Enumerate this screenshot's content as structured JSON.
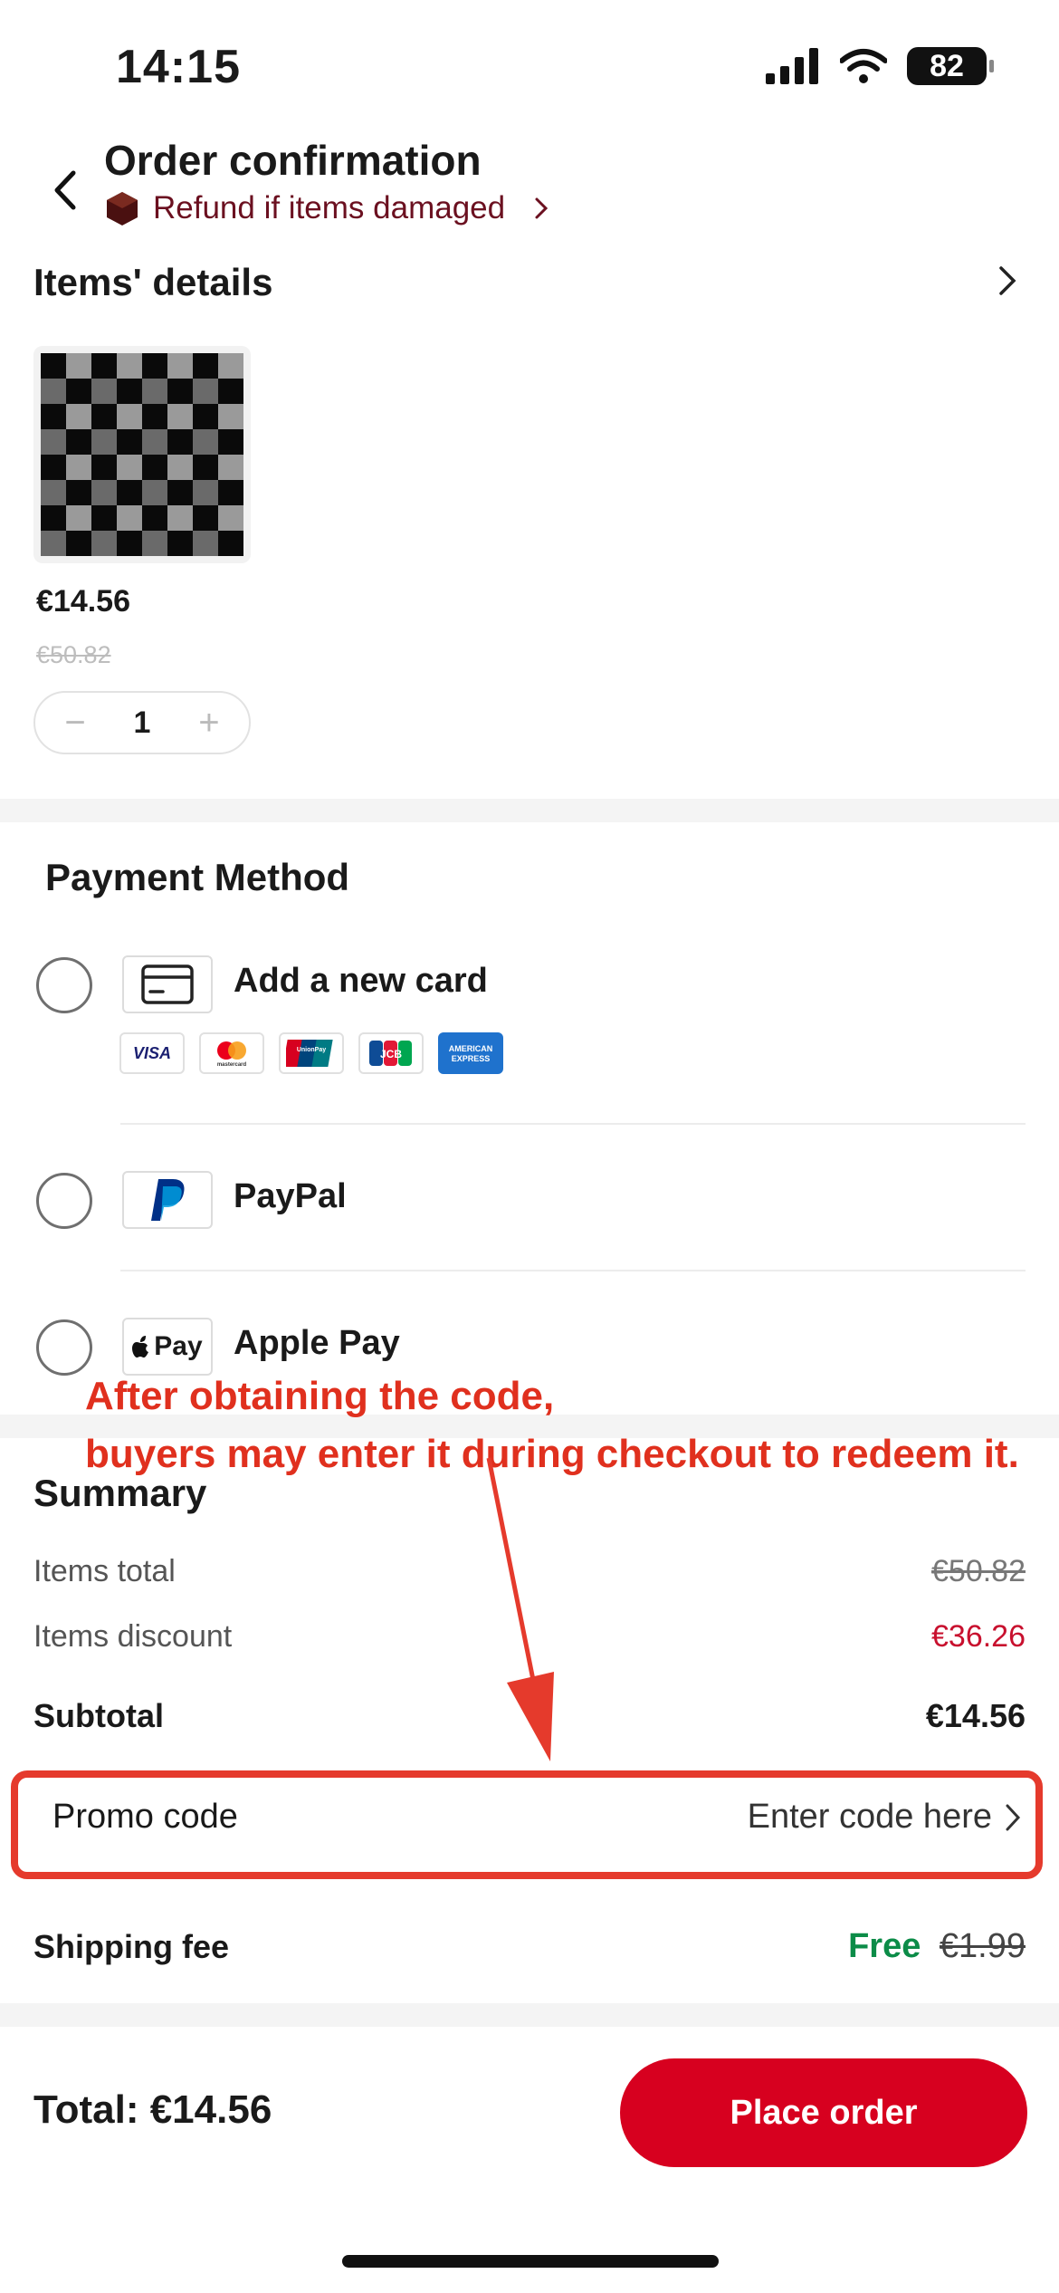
{
  "status": {
    "time": "14:15",
    "battery": "82"
  },
  "header": {
    "title": "Order confirmation",
    "refund_text": "Refund if items damaged"
  },
  "items": {
    "title": "Items' details",
    "price": "€14.56",
    "original_price": "€50.82",
    "quantity": "1",
    "minus": "−",
    "plus": "+"
  },
  "payment": {
    "title": "Payment Method",
    "options": [
      {
        "label": "Add a new card",
        "icon": "credit-card-icon"
      },
      {
        "label": "PayPal",
        "icon": "paypal-icon"
      },
      {
        "label": "Apple Pay",
        "icon": "apple-pay-icon",
        "badge": "Pay"
      }
    ],
    "card_logos": [
      "VISA",
      "mastercard",
      "UnionPay",
      "JCB",
      "AMERICAN EXPRESS"
    ]
  },
  "annotation": {
    "line1": "After obtaining the code,",
    "line2": "buyers may enter it during checkout to redeem it."
  },
  "summary": {
    "title": "Summary",
    "items_total_label": "Items total",
    "items_total_value": "€50.82",
    "items_discount_label": "Items discount",
    "items_discount_value": "€36.26",
    "subtotal_label": "Subtotal",
    "subtotal_value": "€14.56",
    "promo_label": "Promo code",
    "promo_value": "Enter code here",
    "shipping_label": "Shipping fee",
    "shipping_free": "Free",
    "shipping_original": "€1.99"
  },
  "footer": {
    "total": "Total: €14.56",
    "place_order": "Place order"
  },
  "colors": {
    "accent": "#d7001f",
    "discount": "#c8102e",
    "free": "#0c8c48",
    "annotation": "#e53a2c"
  }
}
